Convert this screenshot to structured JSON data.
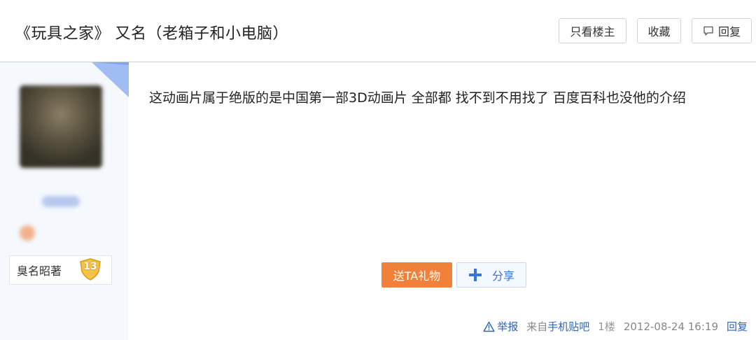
{
  "header": {
    "title": "《玩具之家》 又名（老箱子和小电脑）",
    "only_op_label": "只看楼主",
    "favorite_label": "收藏",
    "reply_label": "回复"
  },
  "user": {
    "rank_name": "臭名昭著",
    "level": "13"
  },
  "post": {
    "text": "这动画片属于绝版的是中国第一部3D动画片 全部都 找不到不用找了 百度百科也没他的介绍",
    "gift_label": "送TA礼物",
    "share_label": "分享"
  },
  "meta": {
    "report_label": "举报",
    "source_prefix": "来自",
    "source_link": "手机贴吧",
    "floor": "1楼",
    "timestamp": "2012-08-24 16:19",
    "reply_label": "回复"
  },
  "colors": {
    "accent_orange": "#f0803a",
    "link_blue": "#2d64b3",
    "sidebar_bg": "#f5f8fd"
  }
}
